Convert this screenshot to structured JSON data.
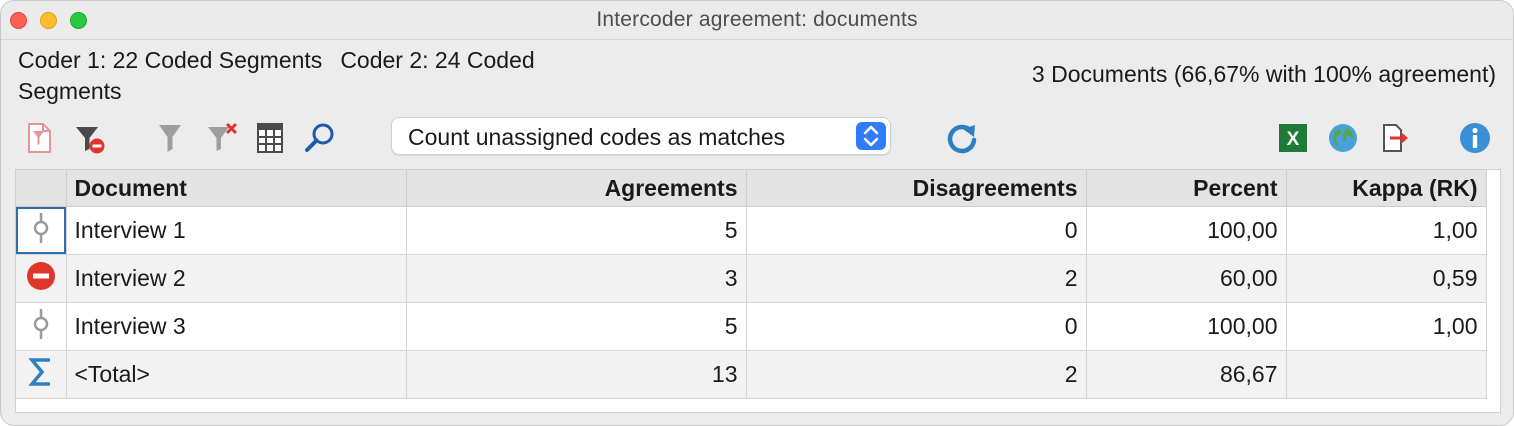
{
  "window": {
    "title": "Intercoder agreement: documents"
  },
  "summary": {
    "coder1": "Coder 1: 22 Coded Segments",
    "coder2": "Coder 2: 24 Coded Segments",
    "documents": "3 Documents (66,67% with 100% agreement)"
  },
  "toolbar": {
    "icons": [
      "filter-document-icon",
      "filter-remove-icon",
      "filter-icon",
      "filter-clear-icon",
      "table-columns-icon",
      "search-icon",
      "refresh-icon",
      "excel-export-icon",
      "web-export-icon",
      "export-icon",
      "info-icon"
    ],
    "dropdown_value": "Count unassigned codes as matches"
  },
  "table": {
    "columns": [
      "Document",
      "Agreements",
      "Disagreements",
      "Percent",
      "Kappa (RK)"
    ],
    "rows": [
      {
        "status_icon": "balanced-icon",
        "document": "Interview 1",
        "agreements": "5",
        "disagreements": "0",
        "percent": "100,00",
        "kappa": "1,00"
      },
      {
        "status_icon": "disagreement-icon",
        "document": "Interview 2",
        "agreements": "3",
        "disagreements": "2",
        "percent": "60,00",
        "kappa": "0,59"
      },
      {
        "status_icon": "balanced-icon",
        "document": "Interview 3",
        "agreements": "5",
        "disagreements": "0",
        "percent": "100,00",
        "kappa": "1,00"
      },
      {
        "status_icon": "sum-icon",
        "document": "<Total>",
        "agreements": "13",
        "disagreements": "2",
        "percent": "86,67",
        "kappa": ""
      }
    ]
  },
  "colors": {
    "close": "#fe5f57",
    "minimize": "#febc2e",
    "maximize": "#28c840",
    "accent": "#2f7cf6",
    "stop_red": "#e0352b"
  }
}
